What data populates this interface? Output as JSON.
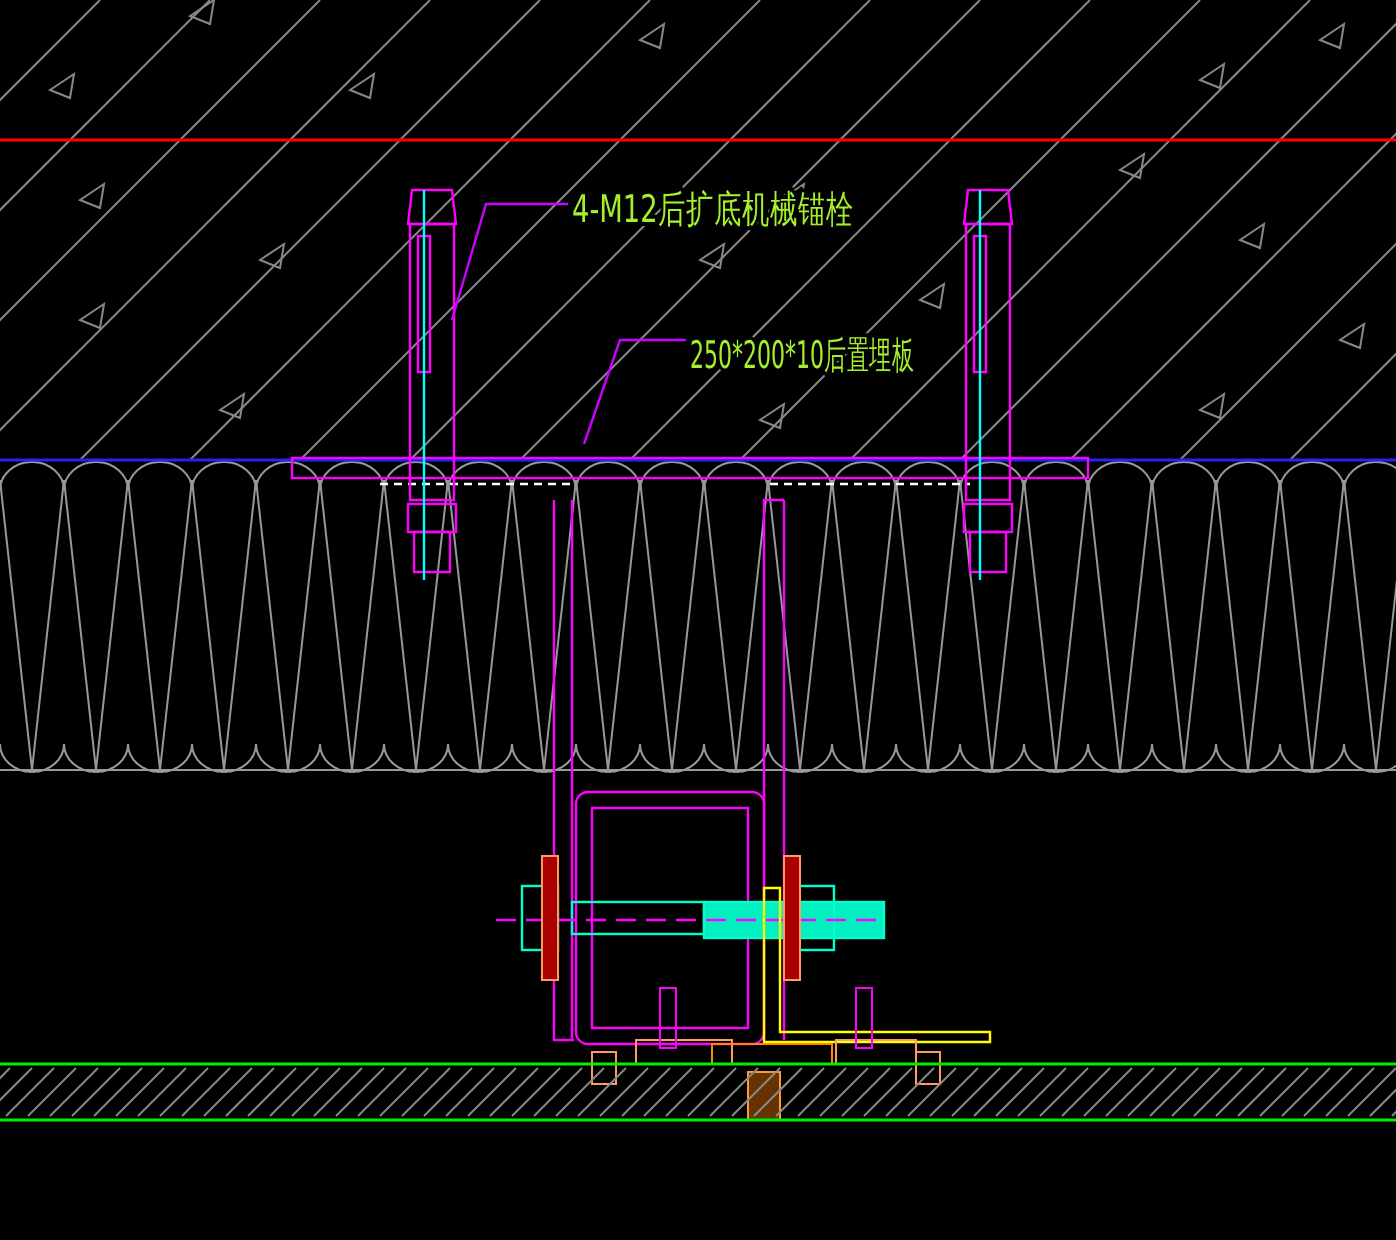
{
  "drawing": {
    "labels": [
      {
        "text": "4-M12后扩底机械锚栓"
      },
      {
        "text": "250*200*10后置埋板"
      }
    ]
  }
}
